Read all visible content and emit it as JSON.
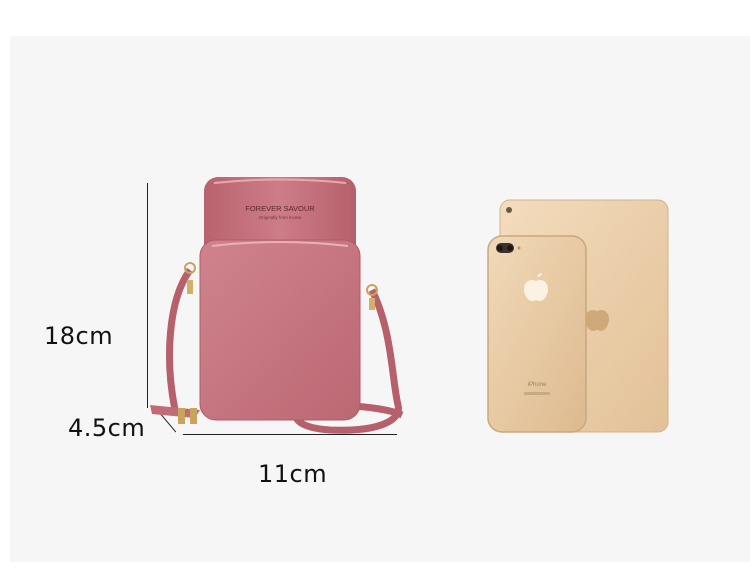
{
  "dimensions": {
    "height_label": "18cm",
    "depth_label": "4.5cm",
    "width_label": "11cm"
  },
  "product": {
    "brand_text": "FOREVER SAVOUR",
    "brand_subtext": "Originally from Korea",
    "bag_color": "#c97681"
  },
  "comparison": {
    "device_text": "iPhone",
    "device_color": "#e8c9a0"
  }
}
